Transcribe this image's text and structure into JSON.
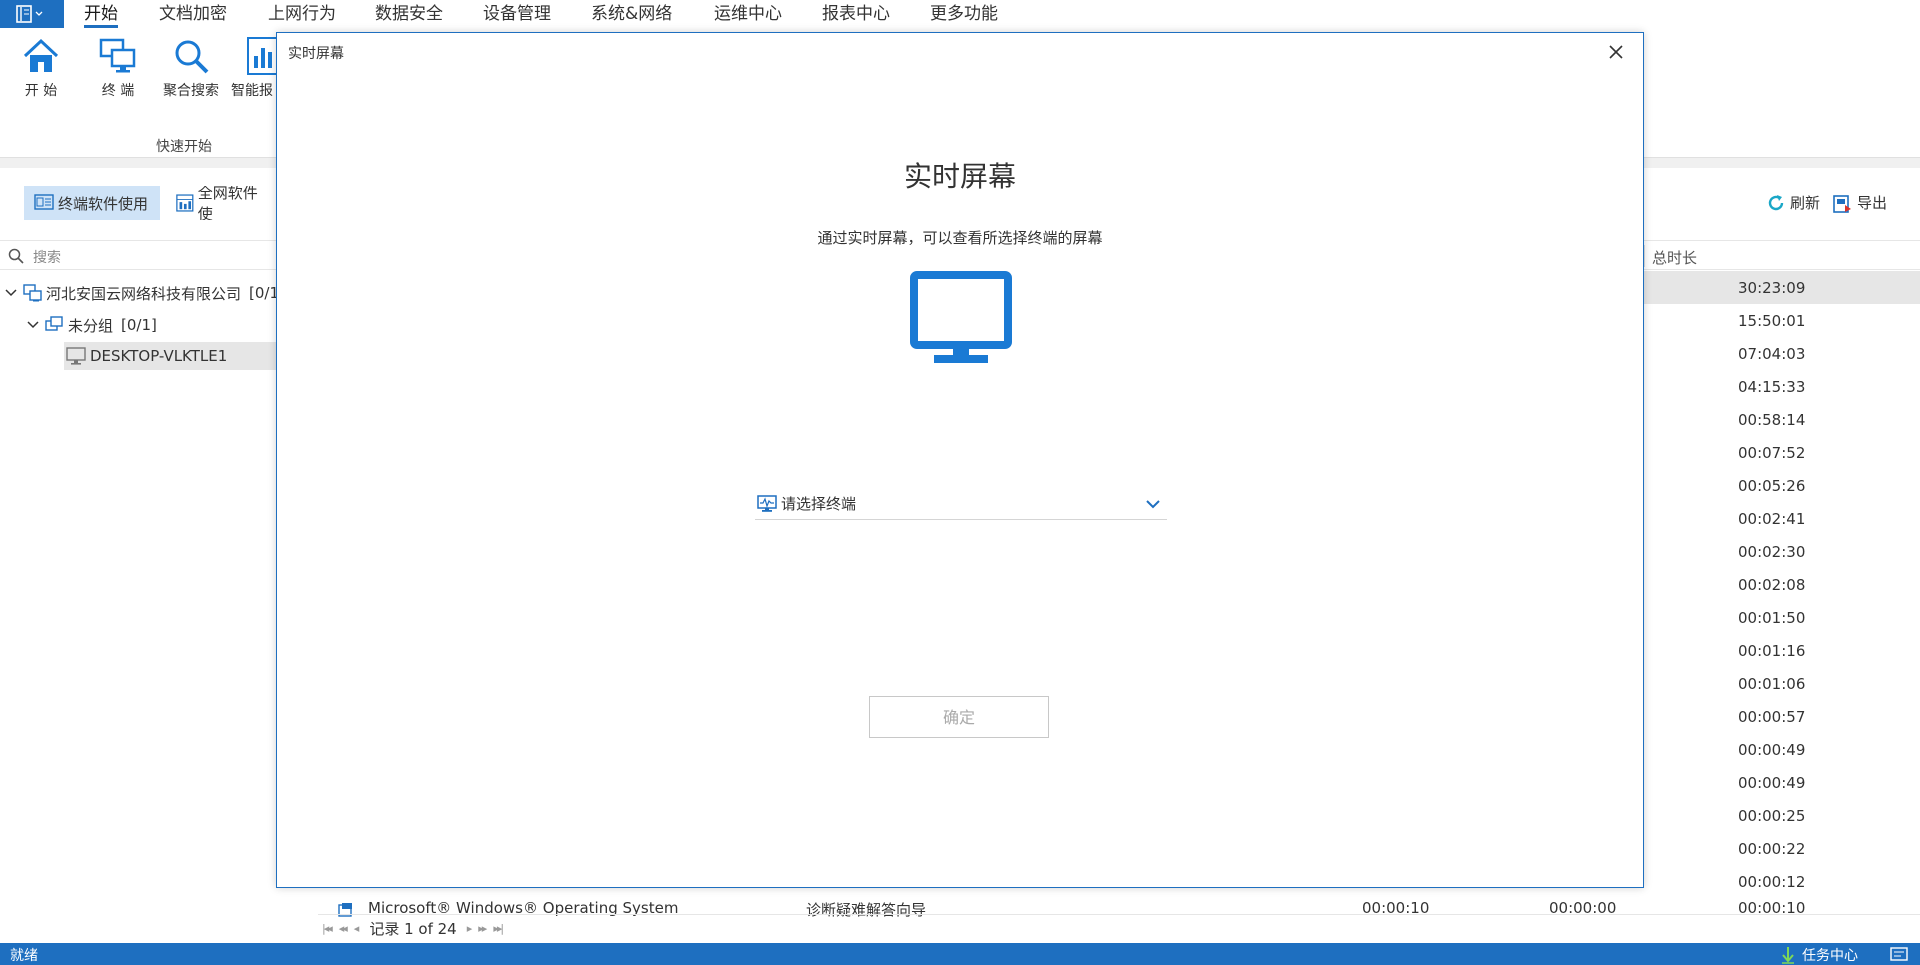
{
  "menu": {
    "items": [
      "开始",
      "文档加密",
      "上网行为",
      "数据安全",
      "设备管理",
      "系统&网络",
      "运维中心",
      "报表中心",
      "更多功能"
    ],
    "active_index": 0
  },
  "ribbon": {
    "buttons": [
      {
        "label": "开 始",
        "icon": "home-icon"
      },
      {
        "label": "终 端",
        "icon": "terminals-icon"
      },
      {
        "label": "聚合搜索",
        "icon": "search-icon"
      },
      {
        "label": "智能报",
        "icon": "report-icon"
      }
    ],
    "group_label": "快速开始"
  },
  "toolbar": {
    "tab_terminal_software": "终端软件使用",
    "tab_network_software": "全网软件使",
    "refresh_label": "刷新",
    "export_label": "导出"
  },
  "left_panel": {
    "search_placeholder": "搜索",
    "tree": {
      "company": "河北安国云网络科技有限公司",
      "company_count": "[0/1",
      "group": "未分组",
      "group_count": "[0/1]",
      "device": "DESKTOP-VLKTLE1"
    }
  },
  "table": {
    "column_total_duration": "总时长",
    "durations": [
      "30:23:09",
      "15:50:01",
      "07:04:03",
      "04:15:33",
      "00:58:14",
      "00:07:52",
      "00:05:26",
      "00:02:41",
      "00:02:30",
      "00:02:08",
      "00:01:50",
      "00:01:16",
      "00:01:06",
      "00:00:57",
      "00:00:49",
      "00:00:49",
      "00:00:25",
      "00:00:22",
      "00:00:12",
      "00:00:10"
    ],
    "selected_row": 0,
    "bottom_row": {
      "product": "Microsoft® Windows® Operating System",
      "app": "诊断疑难解答向导",
      "time1": "00:00:10",
      "time2": "00:00:00"
    },
    "pager": "记录 1 of 24"
  },
  "dialog": {
    "title": "实时屏幕",
    "heading": "实时屏幕",
    "description": "通过实时屏幕，可以查看所选择终端的屏幕",
    "select_placeholder": "请选择终端",
    "ok_label": "确定"
  },
  "status_bar": {
    "left": "就绪",
    "task_center": "任务中心"
  },
  "colors": {
    "accent": "#1e6fc0",
    "monitor_icon": "#1a7ad4",
    "selected_tab_bg": "#cfe3f7"
  }
}
